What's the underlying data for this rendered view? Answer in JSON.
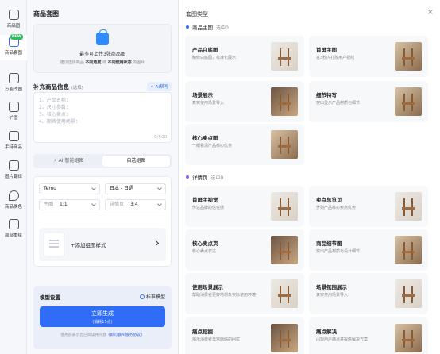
{
  "rail": {
    "items": [
      {
        "label": "商品图",
        "icon": "product-image-icon"
      },
      {
        "label": "商品套图",
        "icon": "product-set-icon",
        "badge": "NEW"
      },
      {
        "label": "万能改图",
        "icon": "magic-edit-icon"
      },
      {
        "label": "扩图",
        "icon": "expand-icon"
      },
      {
        "label": "手持商品",
        "icon": "hand-hold-icon"
      },
      {
        "label": "图片翻译",
        "icon": "translate-icon"
      },
      {
        "label": "商品换色",
        "icon": "recolor-icon"
      },
      {
        "label": "局部重绘",
        "icon": "inpaint-icon"
      }
    ]
  },
  "left": {
    "title": "商品套图",
    "upload": {
      "title": "最多可上传3张商品图",
      "hint_prefix": "建议选择商品",
      "hint_b1": "不同角度",
      "hint_mid": "或",
      "hint_b2": "不同使用状态",
      "hint_suffix": "的图片"
    },
    "info": {
      "title": "补充商品信息",
      "optional": "(选填)",
      "ai_write": "AI帮写",
      "placeholder_lines": [
        "1、产品名称：",
        "2、尺寸参数：",
        "3、核心卖点：",
        "4、期待使用场景："
      ],
      "counter": "0/500"
    },
    "mode": {
      "ai": "AI 智能组图",
      "custom": "自选组图"
    },
    "selects": {
      "platform": "Temu",
      "language": "日本 - 日语",
      "main_label": "主图",
      "main_value": "1:1",
      "detail_label": "详情页",
      "detail_value": "3:4"
    },
    "add_style": "+添加组图样式",
    "model": {
      "label": "模型设置",
      "value": "标准模型",
      "generate": "立即生成",
      "cost": "(消耗15点)",
      "terms_prefix": "使用前表示您已阅读并同意",
      "terms_link": "《即可霸AI服务协议》"
    }
  },
  "right": {
    "title": "套图类型",
    "close": "×",
    "main_section": {
      "title": "商品主图",
      "selected": "选中0",
      "dot_color": "#2f6df6"
    },
    "main_cards": [
      {
        "title": "产品白底图",
        "desc": "精修白底图，标准化展示"
      },
      {
        "title": "首屏主图",
        "desc": "在3秒内打败用户视线"
      },
      {
        "title": "场景展示",
        "desc": "真实使用场景导入"
      },
      {
        "title": "细节特写",
        "desc": "突出显示产品材质与细节"
      },
      {
        "title": "核心卖点图",
        "desc": "一眼看清产品核心优势"
      }
    ],
    "detail_section": {
      "title": "详情页",
      "selected": "选中0",
      "dot_color": "#8b5cf6"
    },
    "detail_cards": [
      {
        "title": "首屏主视觉",
        "desc": "传达品牌的信任感"
      },
      {
        "title": "卖点总览页",
        "desc": "罗列产品核心卖点优势"
      },
      {
        "title": "核心卖点页",
        "desc": "核心卖点表达"
      },
      {
        "title": "商品细节图",
        "desc": "突出产品材质与设计细节"
      },
      {
        "title": "使用场景展示",
        "desc": "帮助消费者更好地想象实际使用环境"
      },
      {
        "title": "场景氛围展示",
        "desc": "真实使用场景导入"
      },
      {
        "title": "痛点挖掘",
        "desc": "揭示消费者日常面临的困扰"
      },
      {
        "title": "痛点解决",
        "desc": "闪现用户痛点并提供解决方案"
      }
    ]
  }
}
